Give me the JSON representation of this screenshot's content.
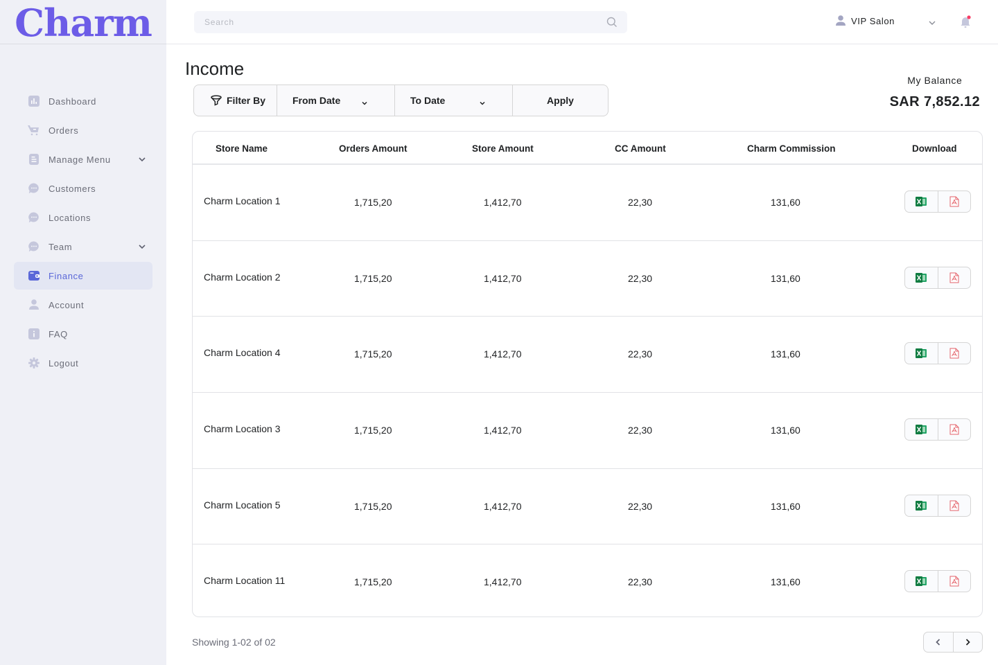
{
  "brand": {
    "logo_text": "Charm",
    "color": "#6c5ce7"
  },
  "sidebar": {
    "items": [
      {
        "label": "Dashboard",
        "icon": "bar-chart-icon",
        "expandable": false,
        "active": false
      },
      {
        "label": "Orders",
        "icon": "cart-icon",
        "expandable": false,
        "active": false
      },
      {
        "label": "Manage Menu",
        "icon": "document-icon",
        "expandable": true,
        "active": false
      },
      {
        "label": "Customers",
        "icon": "chat-icon",
        "expandable": false,
        "active": false
      },
      {
        "label": "Locations",
        "icon": "chat-icon",
        "expandable": false,
        "active": false
      },
      {
        "label": "Team",
        "icon": "chat-icon",
        "expandable": true,
        "active": false
      },
      {
        "label": "Finance",
        "icon": "wallet-icon",
        "expandable": false,
        "active": true
      },
      {
        "label": "Account",
        "icon": "user-icon",
        "expandable": false,
        "active": false
      },
      {
        "label": "FAQ",
        "icon": "info-icon",
        "expandable": false,
        "active": false
      },
      {
        "label": "Logout",
        "icon": "gear-icon",
        "expandable": false,
        "active": false
      }
    ]
  },
  "header": {
    "search_placeholder": "Search",
    "search_value": "",
    "user_name": "VIP Salon",
    "notification_dot_color": "#f93c65"
  },
  "page": {
    "title": "Income",
    "filter": {
      "filter_label": "Filter By",
      "from_label": "From Date",
      "to_label": "To Date",
      "apply_label": "Apply"
    },
    "balance": {
      "label": "My Balance",
      "value": "SAR 7,852.12"
    }
  },
  "table": {
    "columns": [
      "Store Name",
      "Orders Amount",
      "Store Amount",
      "CC Amount",
      "Charm Commission",
      "Download"
    ],
    "rows": [
      {
        "store": "Charm Location 1",
        "orders": "1,715,20",
        "store_amount": "1,412,70",
        "cc": "22,30",
        "commission": "131,60"
      },
      {
        "store": "Charm Location 2",
        "orders": "1,715,20",
        "store_amount": "1,412,70",
        "cc": "22,30",
        "commission": "131,60"
      },
      {
        "store": "Charm Location 4",
        "orders": "1,715,20",
        "store_amount": "1,412,70",
        "cc": "22,30",
        "commission": "131,60"
      },
      {
        "store": "Charm Location 3",
        "orders": "1,715,20",
        "store_amount": "1,412,70",
        "cc": "22,30",
        "commission": "131,60"
      },
      {
        "store": "Charm Location 5",
        "orders": "1,715,20",
        "store_amount": "1,412,70",
        "cc": "22,30",
        "commission": "131,60"
      },
      {
        "store": "Charm Location 11",
        "orders": "1,715,20",
        "store_amount": "1,412,70",
        "cc": "22,30",
        "commission": "131,60"
      }
    ],
    "download_options": [
      "excel-icon",
      "pdf-icon"
    ]
  },
  "pagination": {
    "showing_text": "Showing 1-02 of 02"
  }
}
